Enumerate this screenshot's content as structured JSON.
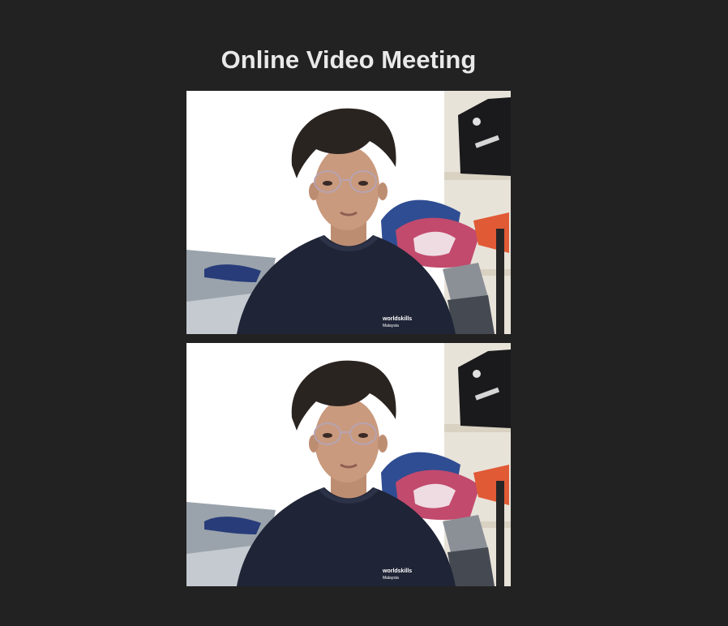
{
  "page": {
    "title": "Online Video Meeting"
  },
  "videos": [
    {
      "name": "local-video",
      "shirt_logo_text": "worldskills",
      "shirt_logo_subtext": "Malaysia"
    },
    {
      "name": "remote-video",
      "shirt_logo_text": "worldskills",
      "shirt_logo_subtext": "Malaysia"
    }
  ],
  "colors": {
    "background": "#222222",
    "title": "#e9e9e9",
    "shirt": "#1f2436",
    "hair": "#2a2420",
    "skin": "#c99a7e",
    "wall": "#ffffff"
  }
}
